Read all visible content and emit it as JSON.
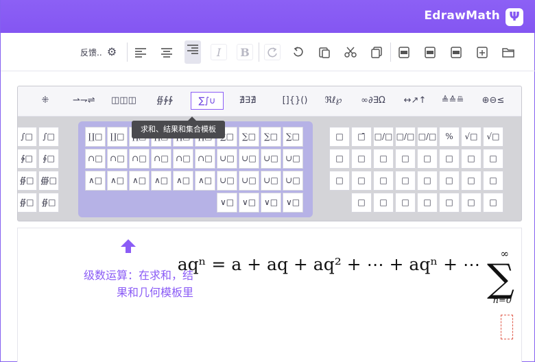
{
  "window": {
    "title": "EdrawMath",
    "logo_glyph": "Ψ",
    "accent": "#8b5cf6"
  },
  "toolbar": {
    "feedback_label": "反馈..",
    "buttons": [
      {
        "name": "open-button",
        "glyph": "open-icon"
      },
      {
        "name": "new-button",
        "glyph": "new-icon"
      },
      {
        "name": "export-png-button",
        "glyph": "png-icon"
      },
      {
        "name": "export-jpeg-button",
        "glyph": "jpeg-icon"
      },
      {
        "name": "export-tex-button",
        "glyph": "tex-icon"
      },
      {
        "name": "paste-button",
        "glyph": "paste-icon"
      },
      {
        "name": "cut-button",
        "glyph": "cut-icon"
      },
      {
        "name": "copy-button",
        "glyph": "copy-icon"
      },
      {
        "name": "redo-button",
        "glyph": "redo-icon"
      },
      {
        "name": "undo-button",
        "glyph": "undo-icon"
      },
      {
        "name": "bold-button",
        "glyph": "B"
      },
      {
        "name": "italic-button",
        "glyph": "I"
      },
      {
        "name": "align-left-button",
        "glyph": "≡"
      },
      {
        "name": "align-center-button",
        "glyph": "≡"
      },
      {
        "name": "align-right-button",
        "glyph": "≡"
      },
      {
        "name": "settings-button",
        "glyph": "⚙"
      }
    ]
  },
  "palette": {
    "categories": [
      "⊕⊖≤",
      "≜≙≞",
      "↔↗↑",
      "∞∂∃Ω",
      "ℜℓ℘",
      "[]{}()",
      "∄∃∄",
      "∑∫∪",
      "∯∲∳",
      "◫◫◫",
      "⇀⇁⇌",
      "▫▫▫"
    ],
    "tooltip": "求和、结果和集合模板",
    "left_cells": [
      "∫□",
      "∫□",
      "∲□",
      "∮□",
      "∯□",
      "∰□",
      "∯□",
      "∯□"
    ],
    "highlight_rows": [
      [
        "∑□",
        "∑□",
        "∑□",
        "∑□",
        "∏□",
        "∏□",
        "∏□",
        "∏□",
        "∐□",
        "∐□"
      ],
      [
        "∪□",
        "∪□",
        "∪□",
        "∪□",
        "∩□",
        "∩□",
        "∩□",
        "∩□",
        "∩□",
        "∩□"
      ],
      [
        "∪□",
        "∪□",
        "∪□",
        "∪□",
        "∧□",
        "∧□",
        "∧□",
        "∧□",
        "∧□",
        "∧□"
      ],
      [
        "∨□",
        "∨□",
        "∨□",
        "∨□"
      ]
    ],
    "right_rows": [
      [
        "□",
        "□̄",
        "□/□",
        "□/□",
        "□/□",
        "%",
        "√□",
        "√□",
        "□̂",
        "□̂",
        "⊼"
      ],
      [
        "□",
        "□",
        "□",
        "□",
        "□",
        "□",
        "□",
        "□",
        "□",
        "□",
        "□"
      ],
      [
        "□",
        "□",
        "□",
        "□",
        "□",
        "□",
        "□",
        "□",
        "□",
        "□",
        "□"
      ],
      [
        "□",
        "□",
        "□",
        "□",
        "□",
        "□",
        "□",
        "□",
        "□",
        "□"
      ]
    ]
  },
  "editor": {
    "hint_line1": "级数运算：在求和，结",
    "hint_line2": "果和几何模板里",
    "formula": {
      "sum_upper": "∞",
      "sum_lower": "n=0",
      "sum_symbol": "∑",
      "series_text": "aqⁿ = a + aq + aq² + ⋯ + aqⁿ + ⋯"
    }
  }
}
